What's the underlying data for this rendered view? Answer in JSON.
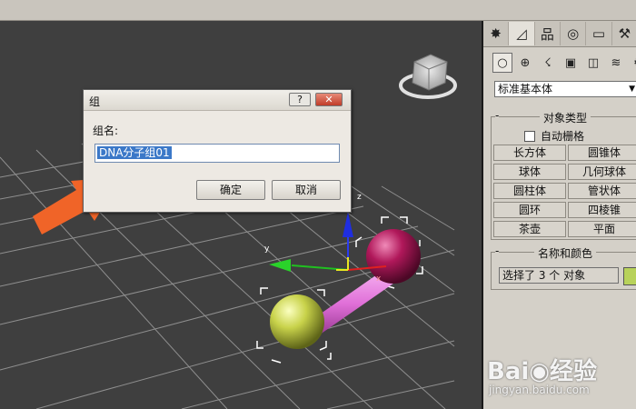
{
  "dialog": {
    "title": "组",
    "help_label": "?",
    "close_label": "✕",
    "group_name_label": "组名:",
    "group_name_value": "DNA分子组01",
    "ok_label": "确定",
    "cancel_label": "取消"
  },
  "panel": {
    "category_value": "标准基本体",
    "object_type": {
      "title": "对象类型",
      "autogrid_label": "自动栅格",
      "buttons": [
        "长方体",
        "圆锥体",
        "球体",
        "几何球体",
        "圆柱体",
        "管状体",
        "圆环",
        "四棱锥",
        "茶壶",
        "平面"
      ]
    },
    "name_color": {
      "title": "名称和颜色",
      "name_value": "选择了 3 个 对象",
      "color": "#b8d25a"
    }
  },
  "viewport": {
    "axis_labels": {
      "x": "x",
      "y": "y",
      "z": "z"
    },
    "sphere_left_color": "#c8d24a",
    "sphere_right_color": "#b0185a",
    "rod_color": "#e878e0",
    "arrow_color": "#f06428"
  },
  "watermark": {
    "logo_text": "Bai◉经验",
    "url": "jingyan.baidu.com"
  }
}
